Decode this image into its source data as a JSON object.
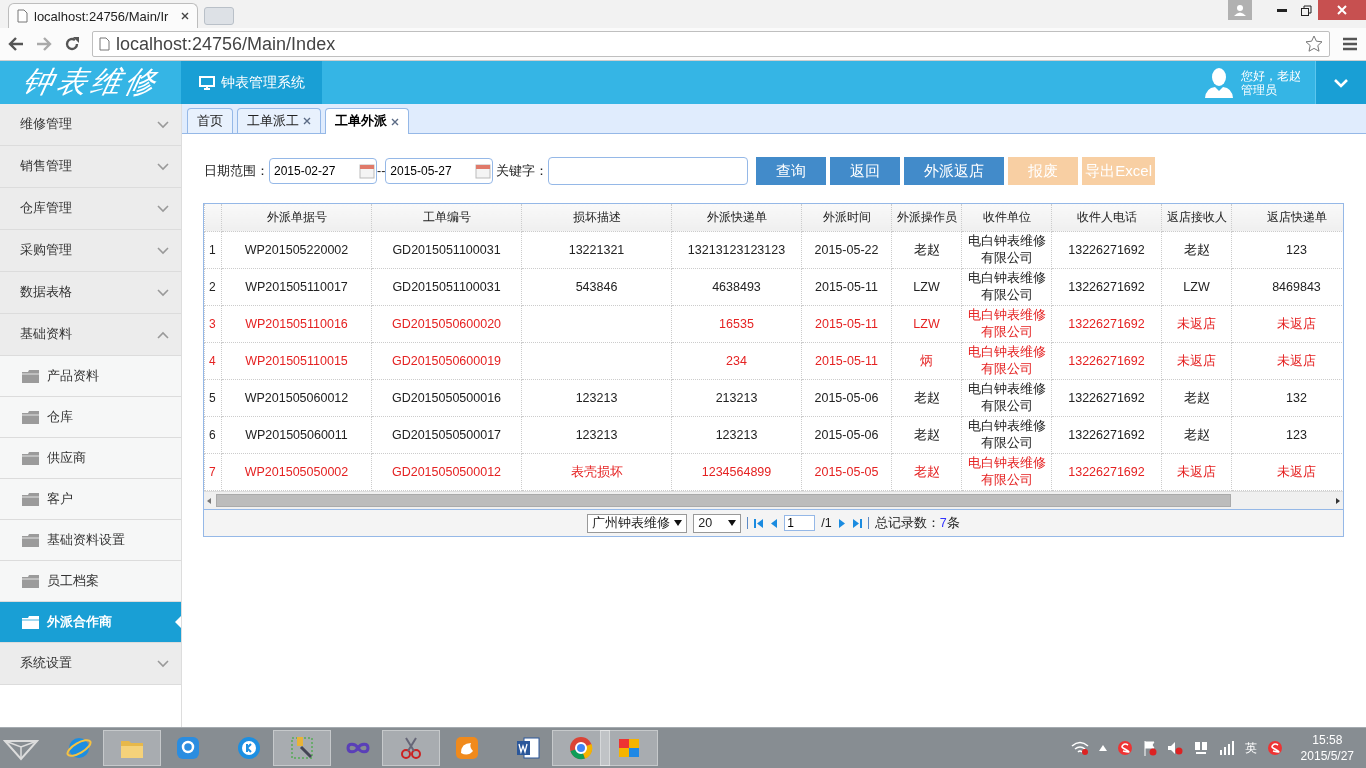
{
  "browser": {
    "tab_title": "localhost:24756/Main/Ir",
    "url": "localhost:24756/Main/Index"
  },
  "header": {
    "logo": "钟表维修",
    "system_title": "钟表管理系统",
    "greeting": "您好，老赵",
    "role": "管理员"
  },
  "sidebar": {
    "items": [
      {
        "label": "维修管理",
        "expanded": false
      },
      {
        "label": "销售管理",
        "expanded": false
      },
      {
        "label": "仓库管理",
        "expanded": false
      },
      {
        "label": "采购管理",
        "expanded": false
      },
      {
        "label": "数据表格",
        "expanded": false
      },
      {
        "label": "基础资料",
        "expanded": true,
        "children": [
          {
            "label": "产品资料",
            "selected": false
          },
          {
            "label": "仓库",
            "selected": false
          },
          {
            "label": "供应商",
            "selected": false
          },
          {
            "label": "客户",
            "selected": false
          },
          {
            "label": "基础资料设置",
            "selected": false
          },
          {
            "label": "员工档案",
            "selected": false
          },
          {
            "label": "外派合作商",
            "selected": true
          }
        ]
      },
      {
        "label": "系统设置",
        "expanded": false
      }
    ]
  },
  "tabs": [
    {
      "label": "首页",
      "selected": false,
      "closable": false
    },
    {
      "label": "工单派工",
      "selected": false,
      "closable": true
    },
    {
      "label": "工单外派",
      "selected": true,
      "closable": true
    }
  ],
  "filters": {
    "date_label": "日期范围：",
    "date_from": "2015-02-27",
    "date_separator": "--",
    "date_to": "2015-05-27",
    "keyword_label": "关键字："
  },
  "buttons": [
    {
      "label": "查询",
      "disabled": false
    },
    {
      "label": "返回",
      "disabled": false
    },
    {
      "label": "外派返店",
      "disabled": false
    },
    {
      "label": "报废",
      "disabled": true
    },
    {
      "label": "导出Excel",
      "disabled": true
    }
  ],
  "table": {
    "columns": [
      "外派单据号",
      "工单编号",
      "损坏描述",
      "外派快递单",
      "外派时间",
      "外派操作员",
      "收件单位",
      "收件人电话",
      "返店接收人",
      "返店快递单"
    ],
    "rows": [
      {
        "number": "1",
        "alert": false,
        "cells": [
          "WP201505220002",
          "GD2015051100031",
          "13221321",
          "13213123123123",
          "2015-05-22",
          "老赵",
          "电白钟表维修有限公司",
          "13226271692",
          "老赵",
          "123"
        ]
      },
      {
        "number": "2",
        "alert": false,
        "cells": [
          "WP201505110017",
          "GD2015051100031",
          "543846",
          "4638493",
          "2015-05-11",
          "LZW",
          "电白钟表维修有限公司",
          "13226271692",
          "LZW",
          "8469843"
        ]
      },
      {
        "number": "3",
        "alert": true,
        "cells": [
          "WP201505110016",
          "GD2015050600020",
          null,
          "16535",
          "2015-05-11",
          "LZW",
          "电白钟表维修有限公司",
          "13226271692",
          "未返店",
          "未返店"
        ]
      },
      {
        "number": "4",
        "alert": true,
        "cells": [
          "WP201505110015",
          "GD2015050600019",
          null,
          "234",
          "2015-05-11",
          "炳",
          "电白钟表维修有限公司",
          "13226271692",
          "未返店",
          "未返店"
        ]
      },
      {
        "number": "5",
        "alert": false,
        "cells": [
          "WP201505060012",
          "GD2015050500016",
          "123213",
          "213213",
          "2015-05-06",
          "老赵",
          "电白钟表维修有限公司",
          "13226271692",
          "老赵",
          "132"
        ]
      },
      {
        "number": "6",
        "alert": false,
        "cells": [
          "WP201505060011",
          "GD2015050500017",
          "123213",
          "123213",
          "2015-05-06",
          "老赵",
          "电白钟表维修有限公司",
          "13226271692",
          "老赵",
          "123"
        ]
      },
      {
        "number": "7",
        "alert": true,
        "cells": [
          "WP201505050002",
          "GD2015050500012",
          "表壳损坏",
          "1234564899",
          "2015-05-05",
          "老赵",
          "电白钟表维修有限公司",
          "13226271692",
          "未返店",
          "未返店"
        ]
      }
    ]
  },
  "pager": {
    "company": "广州钟表维修",
    "page_size": "20",
    "page": "1",
    "page_total": "/1",
    "total_label": "总记录数：",
    "total_count": "7",
    "total_unit": "条"
  },
  "taskbar": {
    "apps": [
      {
        "kind": "browser-e",
        "running": false
      },
      {
        "kind": "folder",
        "running": true
      },
      {
        "kind": "chat",
        "running": false
      },
      {
        "kind": "player",
        "running": false
      },
      {
        "kind": "tools",
        "running": true
      },
      {
        "kind": "infinity",
        "running": false
      },
      {
        "kind": "scissors",
        "running": true
      },
      {
        "kind": "squirrel",
        "running": false
      },
      {
        "kind": "document",
        "running": false
      },
      {
        "kind": "chrome",
        "running": true
      },
      {
        "kind": "tiles",
        "running": true
      }
    ],
    "ime": "英",
    "time": "15:58",
    "date": "2015/5/27"
  }
}
